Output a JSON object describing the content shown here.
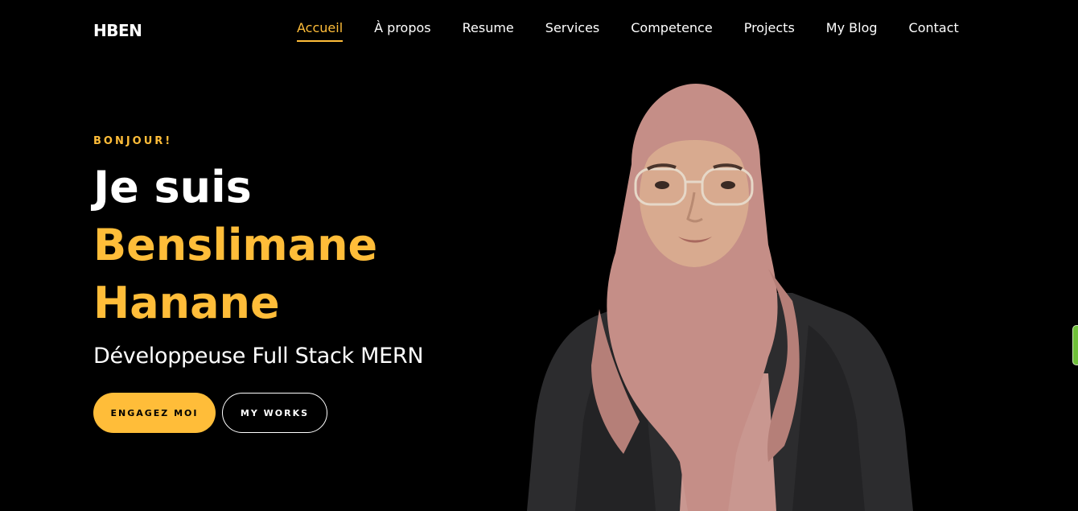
{
  "header": {
    "logo": "HBEN",
    "nav": [
      {
        "label": "Accueil",
        "active": true
      },
      {
        "label": "À propos",
        "active": false
      },
      {
        "label": "Resume",
        "active": false
      },
      {
        "label": "Services",
        "active": false
      },
      {
        "label": "Competence",
        "active": false
      },
      {
        "label": "Projects",
        "active": false
      },
      {
        "label": "My Blog",
        "active": false
      },
      {
        "label": "Contact",
        "active": false
      }
    ]
  },
  "hero": {
    "greeting": "BONJOUR!",
    "heading_line1": "Je suis",
    "heading_line2": "Benslimane",
    "heading_line3": "Hanane",
    "subtitle": "Développeuse Full Stack MERN",
    "primary_button": "ENGAGEZ MOI",
    "secondary_button": "MY WORKS"
  },
  "colors": {
    "background": "#000000",
    "accent": "#ffbd39",
    "text": "#ffffff"
  },
  "icons": {
    "side_tab": "feedback-tab-icon"
  }
}
